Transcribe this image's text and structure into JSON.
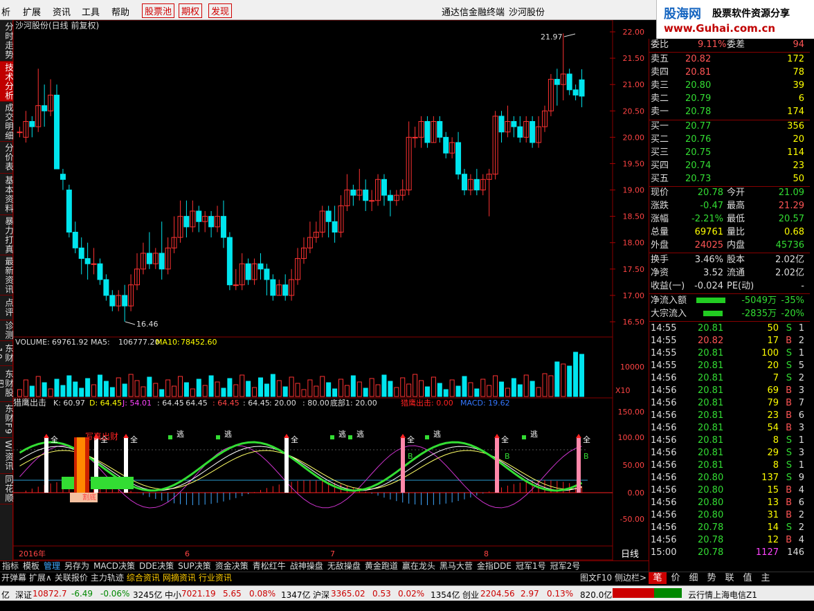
{
  "menu": {
    "items": [
      "析",
      "扩展",
      "资讯",
      "工具",
      "帮助"
    ],
    "red_items": [
      "股票池",
      "期权",
      "发现"
    ],
    "terminal": "通达信金融终端",
    "stock": "沙河股份"
  },
  "brand": {
    "logo": "股海网",
    "slogan": "股票软件资源分享",
    "url": "www.Guhai.com.cn"
  },
  "side_tabs": [
    "分时走势",
    "技术分析",
    "成交明细",
    "分价表",
    "基本资料",
    "暴力打真",
    "最新资讯",
    "点评",
    "诊测",
    "东财10",
    "东财股吧",
    "东财F9",
    "Wi资讯",
    "同花顺"
  ],
  "chart": {
    "title": "沙河股份(日线 前复权)",
    "high_label": "21.97",
    "low_label": "16.46",
    "y_ticks": [
      "22.00",
      "21.50",
      "21.00",
      "20.50",
      "20.00",
      "19.50",
      "19.00",
      "18.50",
      "18.00",
      "17.50",
      "17.00",
      "16.50"
    ],
    "volume": {
      "label": "VOLUME:",
      "value": "69761.92",
      "ma5_label": "MA5:",
      "ma5": "106777.20",
      "ma10_label": "MA10:",
      "ma10": "78452.60",
      "tick": "10000",
      "x10": "X10"
    },
    "indicator": {
      "name": "猎鹰出击",
      "k": "K: 60.97",
      "d": "D: 64.45",
      "j": "J: 54.01",
      "v1": ": 64.45",
      "v2": ": 64.45",
      "v3": ": 64.45",
      "v4": ": 64.45",
      "v5": ": 20.00",
      "v6": ": 80.00",
      "bottom": "底部1: 20.00",
      "sig": "猎鹰出击: 0.00",
      "macd": "MACD: 19.62",
      "ticks": [
        "150.00",
        "100.00",
        "50.00",
        "0.00",
        "-50.00"
      ],
      "quan": "全",
      "tao": "逃",
      "b": "B",
      "xiajiang": "写真出财",
      "jiedi": "割底"
    },
    "x_dates": [
      "2016年",
      "6",
      "7",
      "8"
    ],
    "period": "日线"
  },
  "tabbar": [
    "指标",
    "模板",
    "管理",
    "另存为",
    "MACD决策",
    "DDE决策",
    "SUP决策",
    "资金决策",
    "青松红牛",
    "战神操盘",
    "无敌操盘",
    "黄金跑道",
    "赢在龙头",
    "黑马大营",
    "金指DDE",
    "冠军1号",
    "冠军2号"
  ],
  "funcbar": [
    "开弹幕",
    "扩展∧",
    "关联报价",
    "主力轨迹",
    "综合资讯",
    "网摘资讯",
    "行业资讯"
  ],
  "funcbar_right": [
    "图文F10",
    "侧边栏>"
  ],
  "quote": {
    "wei_bi": "委比",
    "wei_bi_v": "9.11%",
    "wei_cha": "委差",
    "wei_cha_v": "94",
    "sells": [
      [
        "卖五",
        "20.82",
        "172"
      ],
      [
        "卖四",
        "20.81",
        "78"
      ],
      [
        "卖三",
        "20.80",
        "39"
      ],
      [
        "卖二",
        "20.79",
        "6"
      ],
      [
        "卖一",
        "20.78",
        "174"
      ]
    ],
    "buys": [
      [
        "买一",
        "20.77",
        "356"
      ],
      [
        "买二",
        "20.76",
        "20"
      ],
      [
        "买三",
        "20.75",
        "114"
      ],
      [
        "买四",
        "20.74",
        "23"
      ],
      [
        "买五",
        "20.73",
        "50"
      ]
    ],
    "stats": [
      [
        "现价",
        "20.78",
        "今开",
        "21.09"
      ],
      [
        "涨跌",
        "-0.47",
        "最高",
        "21.29"
      ],
      [
        "涨幅",
        "-2.21%",
        "最低",
        "20.57"
      ],
      [
        "总量",
        "69761",
        "量比",
        "0.68"
      ],
      [
        "外盘",
        "24025",
        "内盘",
        "45736"
      ]
    ],
    "fin": [
      [
        "换手",
        "3.46%",
        "股本",
        "2.02亿"
      ],
      [
        "净资",
        "3.52",
        "流通",
        "2.02亿"
      ],
      [
        "收益(一)",
        "-0.024",
        "PE(动)",
        "-"
      ]
    ],
    "flows": [
      [
        "净流入额",
        "-5049万",
        "-35%"
      ],
      [
        "大宗流入",
        "-2835万",
        "-20%"
      ]
    ],
    "ticks": [
      [
        "14:55",
        "20.81",
        "50",
        "S",
        "1"
      ],
      [
        "14:55",
        "20.82",
        "17",
        "B",
        "2"
      ],
      [
        "14:55",
        "20.81",
        "100",
        "S",
        "1"
      ],
      [
        "14:55",
        "20.81",
        "20",
        "S",
        "5"
      ],
      [
        "14:56",
        "20.81",
        "7",
        "S",
        "2"
      ],
      [
        "14:56",
        "20.81",
        "69",
        "B",
        "3"
      ],
      [
        "14:56",
        "20.81",
        "79",
        "B",
        "7"
      ],
      [
        "14:56",
        "20.81",
        "23",
        "B",
        "6"
      ],
      [
        "14:56",
        "20.81",
        "54",
        "B",
        "3"
      ],
      [
        "14:56",
        "20.81",
        "8",
        "S",
        "1"
      ],
      [
        "14:56",
        "20.81",
        "29",
        "S",
        "3"
      ],
      [
        "14:56",
        "20.81",
        "8",
        "S",
        "1"
      ],
      [
        "14:56",
        "20.80",
        "137",
        "S",
        "9"
      ],
      [
        "14:56",
        "20.80",
        "15",
        "B",
        "4"
      ],
      [
        "14:56",
        "20.80",
        "13",
        "B",
        "6"
      ],
      [
        "14:56",
        "20.80",
        "31",
        "B",
        "2"
      ],
      [
        "14:56",
        "20.78",
        "14",
        "S",
        "2"
      ],
      [
        "14:56",
        "20.78",
        "12",
        "B",
        "4"
      ],
      [
        "15:00",
        "20.78",
        "1127",
        "",
        "146"
      ]
    ]
  },
  "bottom_tabs": [
    "笔",
    "价",
    "细",
    "势",
    "联",
    "值",
    "主"
  ],
  "status": {
    "yi": "亿",
    "sz": "深证",
    "sz_v": "10872.7",
    "sz_c": "-6.49",
    "sz_p": "-0.06%",
    "sz_a": "3245亿",
    "zx": "中小",
    "zx_v": "7021.19",
    "zx_c": "5.65",
    "zx_p": "0.08%",
    "zx_a": "1347亿",
    "hs": "沪深",
    "hs_v": "3365.02",
    "hs_c": "0.53",
    "hs_p": "0.02%",
    "hs_a": "1354亿",
    "cy": "创业",
    "cy_v": "2204.56",
    "cy_c": "2.97",
    "cy_p": "0.13%",
    "cy_a": "820.0亿",
    "server": "云行情上海电信Z1"
  },
  "colors": {
    "up": "#ff3232",
    "down": "#00e5ee",
    "ma_green": "#33dd33",
    "yellow": "#ffff00",
    "white": "#ffffff",
    "magenta": "#ff44ff"
  }
}
